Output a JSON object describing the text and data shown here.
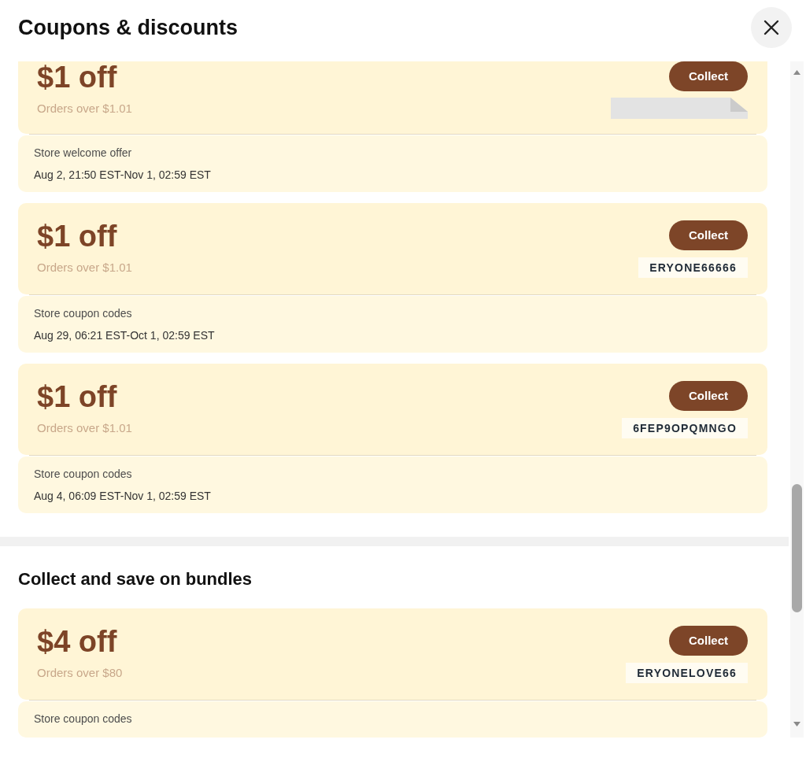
{
  "header": {
    "title": "Coupons & discounts"
  },
  "coupons": [
    {
      "amount": "$1 off",
      "condition": "Orders over $1.01",
      "button": "Collect",
      "code": {
        "kind": "hidden"
      },
      "label": "Store welcome offer",
      "validity": "Aug 2, 21:50 EST-Nov 1, 02:59 EST"
    },
    {
      "amount": "$1 off",
      "condition": "Orders over $1.01",
      "button": "Collect",
      "code": {
        "kind": "text",
        "text": "ERYONE66666"
      },
      "label": "Store coupon codes",
      "validity": "Aug 29, 06:21 EST-Oct 1, 02:59 EST"
    },
    {
      "amount": "$1 off",
      "condition": "Orders over $1.01",
      "button": "Collect",
      "code": {
        "kind": "text",
        "text": "6FEP9OPQMNGO"
      },
      "label": "Store coupon codes",
      "validity": "Aug 4, 06:09 EST-Nov 1, 02:59 EST"
    }
  ],
  "bundles": {
    "heading": "Collect and save on bundles",
    "coupons": [
      {
        "amount": "$4 off",
        "condition": "Orders over $80",
        "button": "Collect",
        "code": {
          "kind": "text",
          "text": "ERYONELOVE66"
        },
        "label": "Store coupon codes"
      }
    ]
  }
}
